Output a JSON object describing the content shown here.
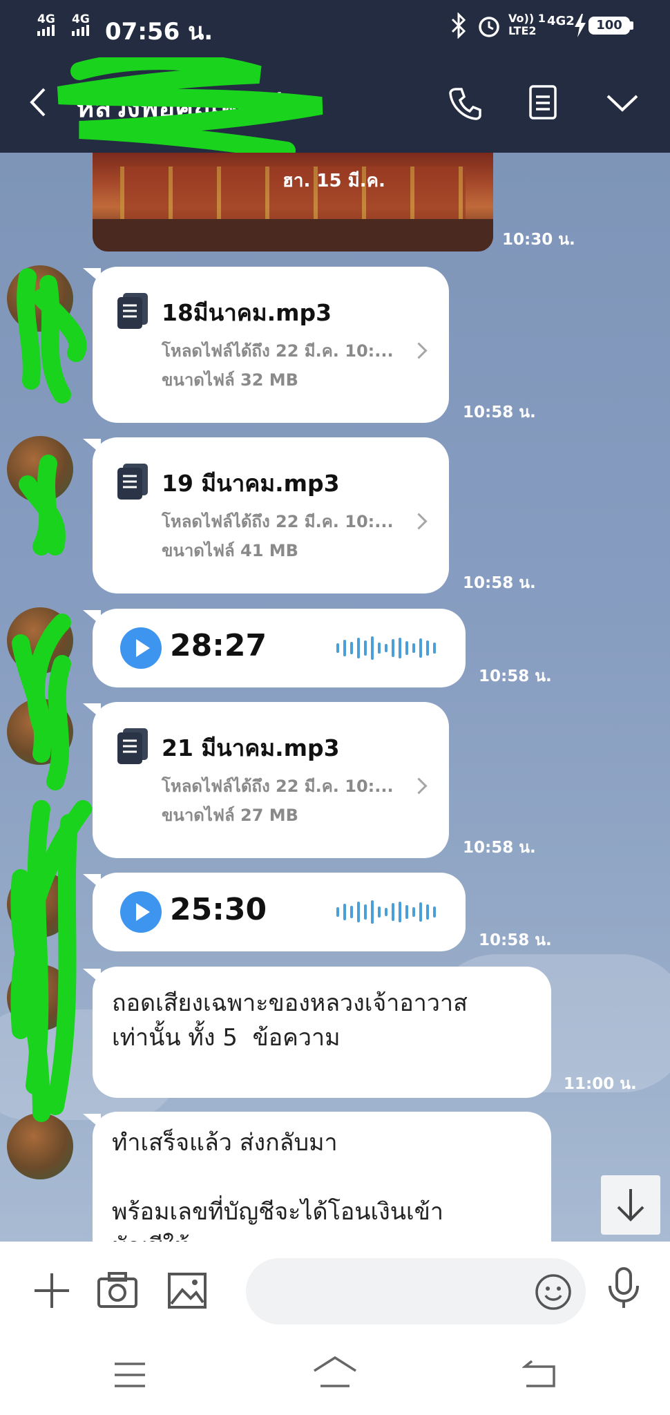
{
  "status_bar": {
    "signal1": "4G",
    "signal2": "4G",
    "time": "07:56 น.",
    "volte": "Vo)) 1\nLTE2",
    "net": "4G2",
    "battery": "100"
  },
  "header": {
    "title": "หลวงพ่อคุณพัฒน์",
    "icons": [
      "back-icon",
      "phone-icon",
      "notes-icon",
      "chevron-down-icon"
    ]
  },
  "chat": {
    "top_image": {
      "caption": "ฮา. 15 มี.ค.",
      "time": "10:30 น."
    },
    "messages": [
      {
        "type": "file",
        "name": "18มีนาคม.mp3",
        "expiry": "โหลดไฟล์ได้ถึง 22 มี.ค. 10:...",
        "size": "ขนาดไฟล์ 32 MB",
        "time": "10:58 น."
      },
      {
        "type": "file",
        "name": "19 มีนาคม.mp3",
        "expiry": "โหลดไฟล์ได้ถึง 22 มี.ค. 10:...",
        "size": "ขนาดไฟล์ 41 MB",
        "time": "10:58 น."
      },
      {
        "type": "voice",
        "duration": "28:27",
        "time": "10:58 น."
      },
      {
        "type": "file",
        "name": "21 มีนาคม.mp3",
        "expiry": "โหลดไฟล์ได้ถึง 22 มี.ค. 10:...",
        "size": "ขนาดไฟล์ 27 MB",
        "time": "10:58 น."
      },
      {
        "type": "voice",
        "duration": "25:30",
        "time": "10:58 น."
      },
      {
        "type": "text",
        "text": "ถอดเสียงเฉพาะของหลวงเจ้าอาวาส\nเท่านั้น ทั้ง 5  ข้อความ",
        "time": "11:00 น."
      },
      {
        "type": "text",
        "text": "ทำเสร็จแล้ว ส่งกลับมา\n\nพร้อมเลขที่บัญชีจะได้โอนเงินเข้า\nบัญชีให้"
      }
    ]
  },
  "input_bar": {
    "placeholder": "",
    "icons": [
      "plus-icon",
      "camera-icon",
      "image-icon",
      "emoji-icon",
      "microphone-icon"
    ]
  },
  "nav_bar": {
    "icons": [
      "menu-icon",
      "home-icon",
      "back-nav-icon"
    ]
  },
  "colors": {
    "header_bg": "#232c40",
    "accent_play": "#3d95f0",
    "scribble": "#19d31c"
  }
}
